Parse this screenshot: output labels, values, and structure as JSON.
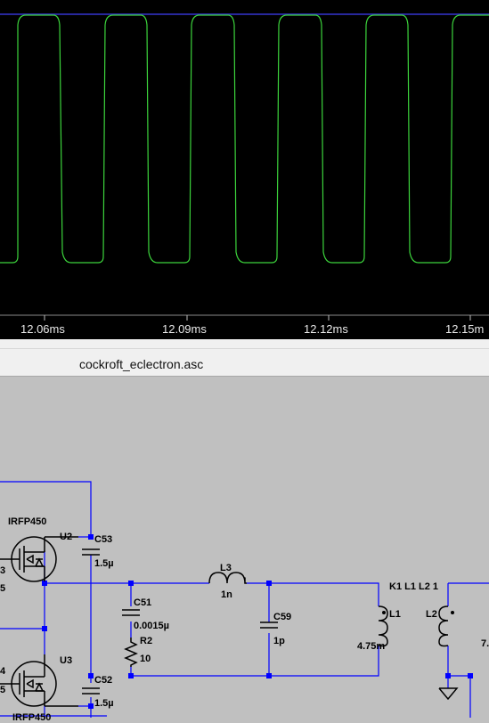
{
  "plot": {
    "x_ticks": [
      "12.06ms",
      "12.09ms",
      "12.12ms",
      "12.15m"
    ],
    "colors": {
      "background": "#000000",
      "trace": "#3cd43c",
      "rail": "#3434d0",
      "tick_text": "#e8e8e8"
    }
  },
  "schematic": {
    "title": "cockroft_eclectron.asc",
    "components": {
      "u2": {
        "model": "IRFP450",
        "ref": "U2"
      },
      "u3": {
        "ref": "U3",
        "model_partial": "IRFP450"
      },
      "c53": {
        "ref": "C53",
        "value": "1.5µ"
      },
      "c52": {
        "ref": "C52",
        "value": "1.5µ"
      },
      "c51": {
        "ref": "C51",
        "value": "0.0015µ"
      },
      "r2": {
        "ref": "R2",
        "value": "10"
      },
      "l3": {
        "ref": "L3",
        "value": "1n"
      },
      "c59": {
        "ref": "C59",
        "value": "1p"
      },
      "l1": {
        "ref": "L1",
        "value": "4.75m"
      },
      "l2": {
        "ref": "L2",
        "value_partial": "7."
      },
      "k1": {
        "directive": "K1 L1 L2 1"
      }
    },
    "edge_fragments": [
      "3",
      "5",
      "4",
      "5"
    ],
    "colors": {
      "wire": "#0000ff",
      "junction": "#0000ff",
      "component": "#000000",
      "background": "#c0c0c0"
    }
  }
}
